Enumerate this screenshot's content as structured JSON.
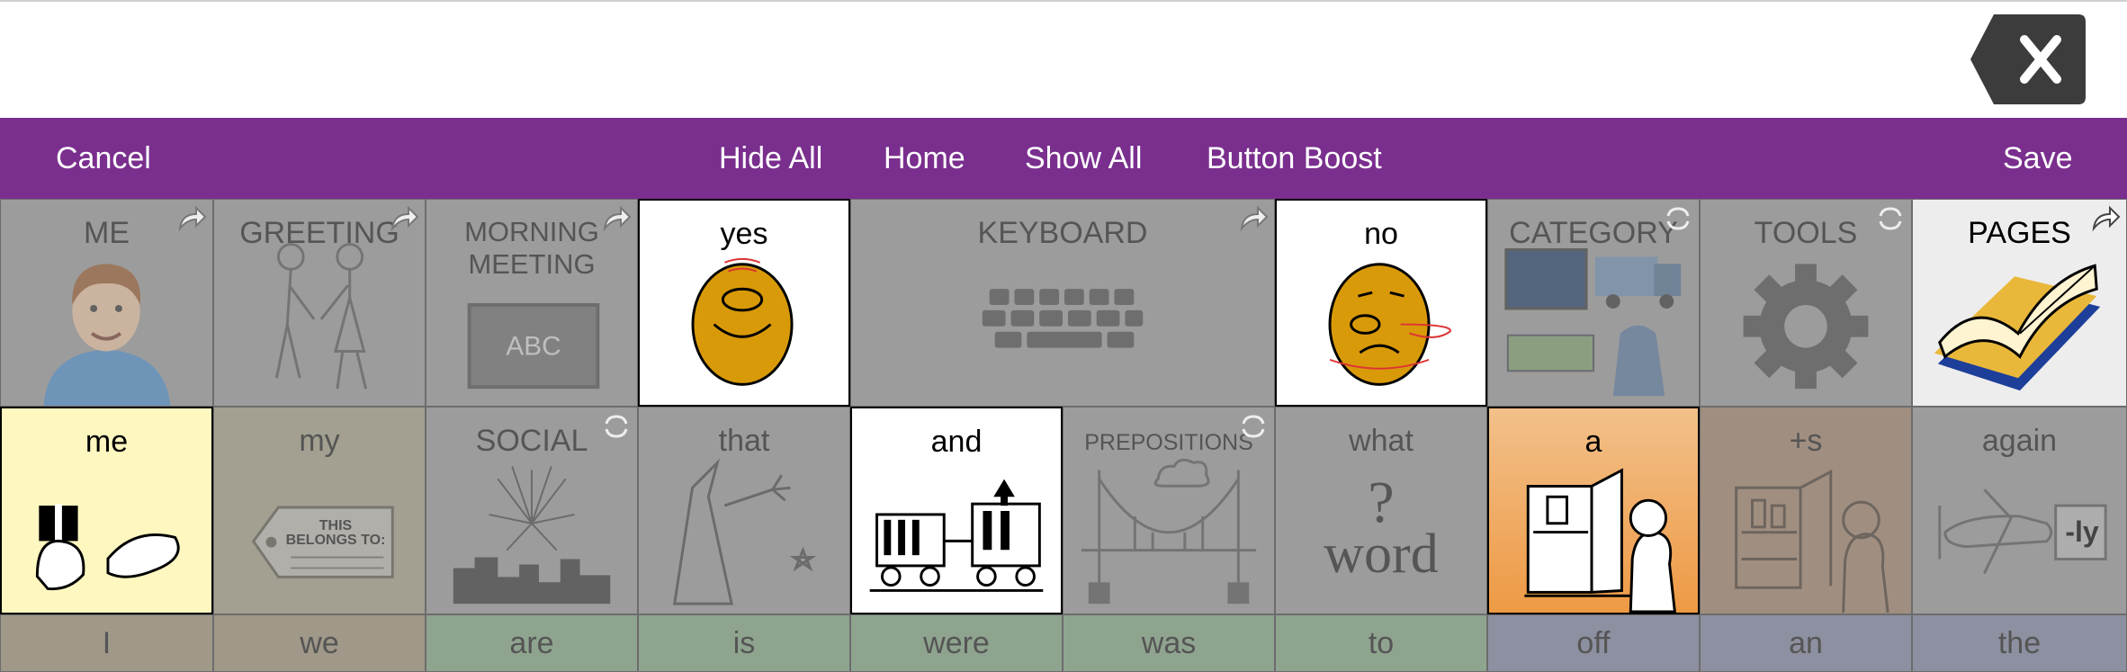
{
  "toolbar": {
    "cancel": "Cancel",
    "hide_all": "Hide All",
    "home": "Home",
    "show_all": "Show All",
    "button_boost": "Button Boost",
    "save": "Save"
  },
  "colors": {
    "toolbar_bg": "#7a2f8e",
    "hidden_cell": "#9c9c9c",
    "visible_cell": "#ffffff",
    "yellow_cell": "#fff7c0",
    "orange_cell": "#f0a050",
    "pages_cell": "#ededed"
  },
  "grid": {
    "row1": [
      {
        "label": "ME",
        "icon": "boy-portrait-icon",
        "state": "hidden",
        "link": "arrow"
      },
      {
        "label": "GREETING",
        "icon": "girls-holding-hands-icon",
        "state": "hidden",
        "link": "arrow"
      },
      {
        "label": "MORNING\nMEETING",
        "icon": "chalkboard-abc-icon",
        "state": "hidden",
        "link": "arrow"
      },
      {
        "label": "yes",
        "icon": "nodding-face-icon",
        "state": "visible"
      },
      {
        "label": "KEYBOARD",
        "icon": "keyboard-icon",
        "state": "hidden",
        "link": "arrow"
      },
      {
        "label": "no",
        "icon": "shaking-head-face-icon",
        "state": "visible"
      },
      {
        "label": "CATEGORY",
        "icon": "category-collage-icon",
        "state": "hidden",
        "link": "loop"
      },
      {
        "label": "TOOLS",
        "icon": "gear-icon",
        "state": "hidden",
        "link": "loop"
      },
      {
        "label": "PAGES",
        "icon": "open-book-icon",
        "state": "visible",
        "link": "arrow"
      }
    ],
    "row2": [
      {
        "label": "me",
        "icon": "give-gift-icon",
        "state": "visible"
      },
      {
        "label": "my",
        "icon": "tag-this-belongs-to-icon",
        "state": "hidden",
        "tag_text": "THIS\nBELONGS TO:"
      },
      {
        "label": "SOCIAL",
        "icon": "fireworks-city-icon",
        "state": "hidden",
        "link": "loop"
      },
      {
        "label": "that",
        "icon": "wizard-wand-icon",
        "state": "hidden"
      },
      {
        "label": "and",
        "icon": "train-cars-icon",
        "state": "visible"
      },
      {
        "label": "PREPOSITIONS",
        "icon": "bridge-cloud-icon",
        "state": "hidden",
        "link": "loop"
      },
      {
        "label": "what",
        "icon": "question-word-icon",
        "state": "hidden",
        "symbol_text": "?",
        "symbol_word": "word"
      },
      {
        "label": "a",
        "icon": "person-at-fridge-icon",
        "state": "visible"
      },
      {
        "label": "+s",
        "icon": "person-at-cupboard-icon",
        "state": "hidden"
      },
      {
        "label": "again",
        "icon": "airplane-ly-icon",
        "state": "hidden",
        "suffix": "-ly"
      }
    ],
    "row3": [
      {
        "label": "I"
      },
      {
        "label": "we"
      },
      {
        "label": "are"
      },
      {
        "label": "is"
      },
      {
        "label": "were"
      },
      {
        "label": "was"
      },
      {
        "label": "to"
      },
      {
        "label": "off"
      },
      {
        "label": "an"
      },
      {
        "label": "the"
      }
    ]
  }
}
